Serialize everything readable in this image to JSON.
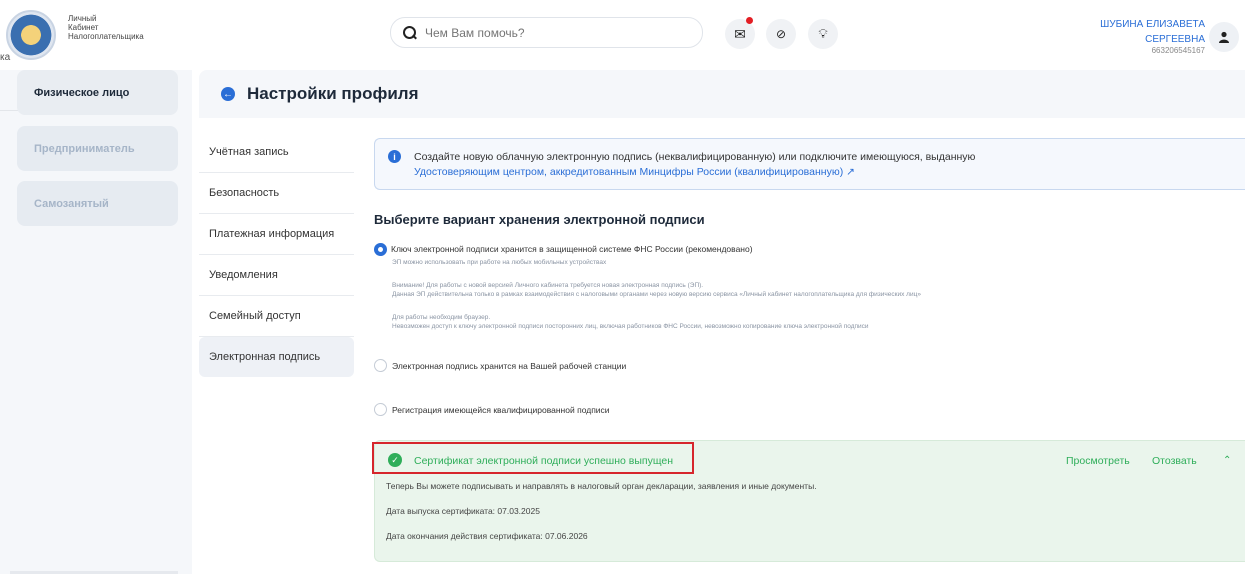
{
  "header": {
    "brand_line1": "Личный",
    "brand_line2": "Кабинет",
    "brand_line3": "Налогоплательщика",
    "left_cut": "ка",
    "search_placeholder": "Чем Вам помочь?",
    "user_line1": "ШУБИНА ЕЛИЗАВЕТА",
    "user_line2": "СЕРГЕЕВНА",
    "user_inn": "663206545167"
  },
  "roles": [
    {
      "label": "Физическое лицо"
    },
    {
      "label": "Предприниматель"
    },
    {
      "label": "Самозанятый"
    }
  ],
  "page": {
    "title": "Настройки профиля"
  },
  "menu": [
    {
      "label": "Учётная запись"
    },
    {
      "label": "Безопасность"
    },
    {
      "label": "Платежная информация"
    },
    {
      "label": "Уведомления"
    },
    {
      "label": "Семейный доступ"
    },
    {
      "label": "Электронная подпись"
    }
  ],
  "info": {
    "text": "Создайте новую облачную электронную подпись (неквалифицированную) или подключите имеющуюся, выданную",
    "link": "Удостоверяющим центром, аккредитованным Минцифры России (квалифицированную)"
  },
  "section_title": "Выберите вариант хранения электронной подписи",
  "options": {
    "opt1_label": "Ключ электронной подписи хранится в защищенной системе ФНС России (рекомендовано)",
    "opt1_note1": "ЭП можно использовать при работе на любых мобильных устройствах",
    "opt1_note2": "Внимание! Для работы с новой версией Личного кабинета требуется новая электронная подпись (ЭП).",
    "opt1_note3": "Данная ЭП действительна только в рамках взаимодействия с налоговыми органами через новую версию сервиса «Личный кабинет налогоплательщика для физических лиц»",
    "opt1_note4": "Для работы необходим браузер.",
    "opt1_note5": "Невозможен доступ к ключу электронной подписи посторонних лиц, включая работников ФНС России, невозможно копирование ключа электронной подписи",
    "opt2_label": "Электронная подпись хранится на Вашей рабочей станции",
    "opt3_label": "Регистрация имеющейся квалифицированной подписи"
  },
  "certificate": {
    "title": "Сертификат электронной подписи успешно выпущен",
    "view": "Просмотреть",
    "revoke": "Отозвать",
    "desc": "Теперь Вы можете подписывать и направлять в налоговый орган декларации, заявления и иные документы.",
    "issue_date": "Дата выпуска сертификата: 07.03.2025",
    "expiry_date": "Дата окончания действия сертификата: 07.06.2026"
  },
  "colors": {
    "accent": "#2a6ed6",
    "success": "#2fae5a",
    "highlight": "#d6262c",
    "notification": "#e31e24"
  }
}
